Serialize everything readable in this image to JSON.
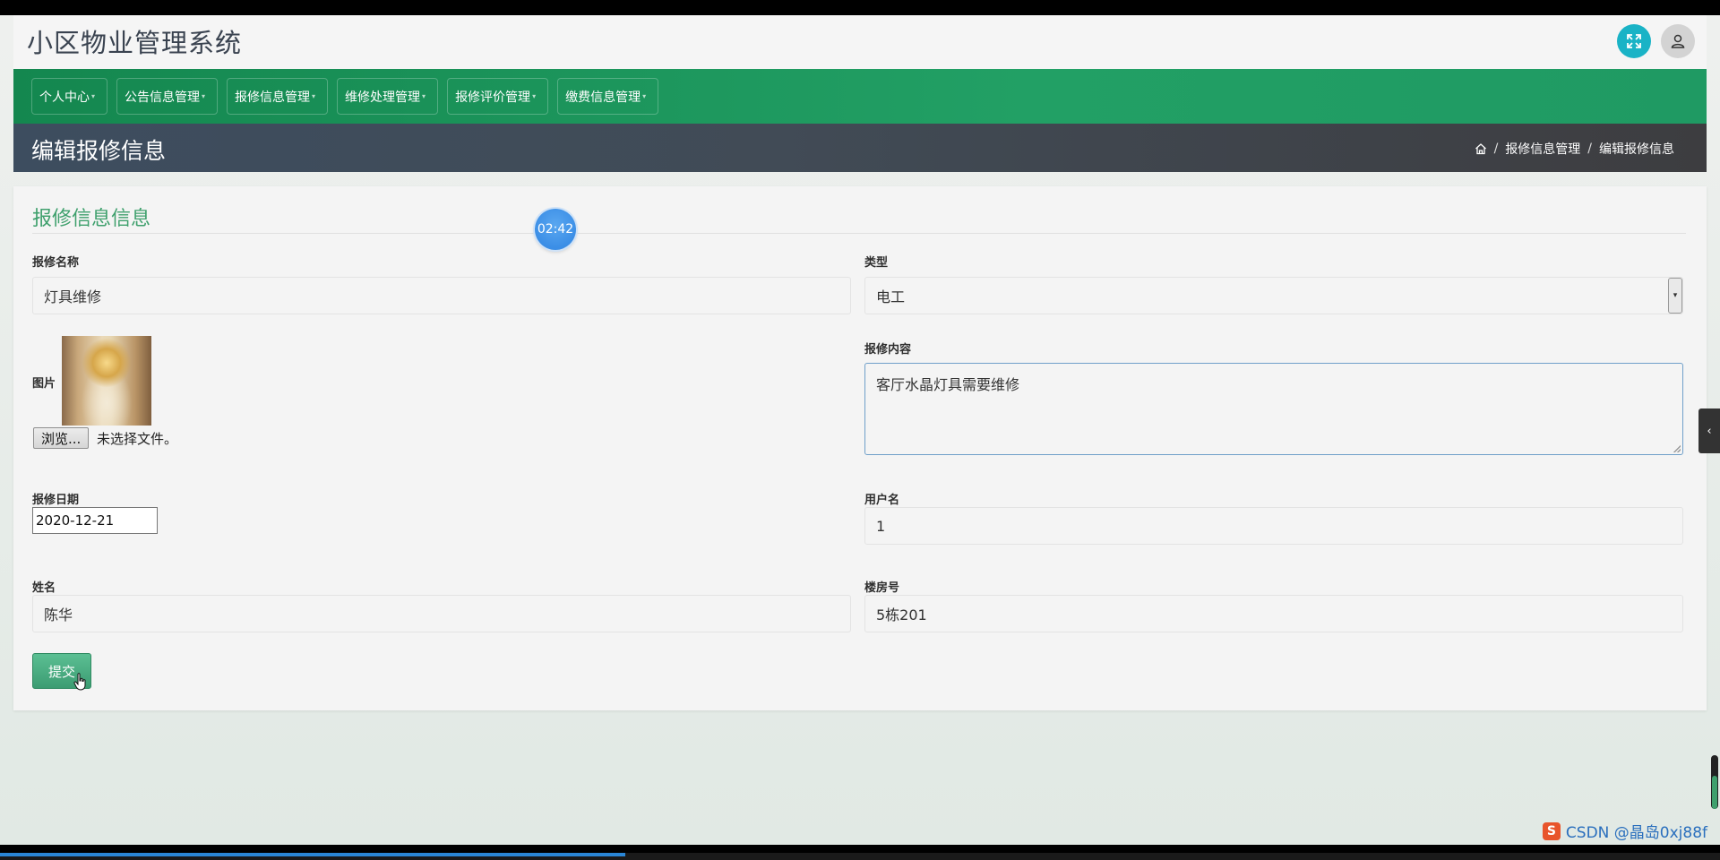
{
  "header": {
    "site_title": "小区物业管理系统",
    "expand_icon": "expand-arrows-icon",
    "user_icon": "user-icon"
  },
  "nav": {
    "items": [
      {
        "label": "个人中心"
      },
      {
        "label": "公告信息管理"
      },
      {
        "label": "报修信息管理"
      },
      {
        "label": "维修处理管理"
      },
      {
        "label": "报修评价管理"
      },
      {
        "label": "缴费信息管理"
      }
    ]
  },
  "page": {
    "title": "编辑报修信息",
    "breadcrumb": {
      "home_icon": "home-icon",
      "separator": "/",
      "section": "报修信息管理",
      "current": "编辑报修信息"
    }
  },
  "form": {
    "section_title": "报修信息信息",
    "repair_name": {
      "label": "报修名称",
      "value": "灯具维修"
    },
    "type": {
      "label": "类型",
      "value": "电工"
    },
    "image": {
      "label": "图片",
      "browse_label": "浏览...",
      "file_status": "未选择文件。"
    },
    "content": {
      "label": "报修内容",
      "value": "客厅水晶灯具需要维修"
    },
    "repair_date": {
      "label": "报修日期",
      "value": "2020-12-21"
    },
    "username": {
      "label": "用户名",
      "value": "1"
    },
    "name": {
      "label": "姓名",
      "value": "陈华"
    },
    "building": {
      "label": "楼房号",
      "value": "5栋201"
    },
    "submit_label": "提交"
  },
  "overlay": {
    "timer": "02:42",
    "watermark": "CSDN @晶岛0xj88f"
  },
  "colors": {
    "nav_green": "#1f9a63",
    "accent_green": "#3fa06d",
    "expand_button": "#1ab3c6",
    "header_band": "#3d4d5f"
  }
}
